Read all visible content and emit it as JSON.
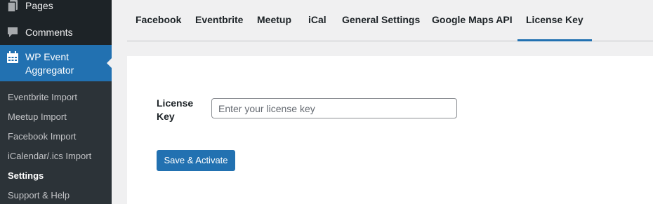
{
  "sidebar": {
    "menu": [
      {
        "label": "Pages",
        "icon": "pages-icon"
      },
      {
        "label": "Comments",
        "icon": "comments-icon"
      }
    ],
    "active": {
      "label": "WP Event Aggregator",
      "icon": "calendar-icon"
    },
    "submenu": [
      {
        "label": "Eventbrite Import"
      },
      {
        "label": "Meetup Import"
      },
      {
        "label": "Facebook Import"
      },
      {
        "label": "iCalendar/.ics Import"
      },
      {
        "label": "Settings",
        "current": true
      },
      {
        "label": "Support & Help"
      }
    ]
  },
  "tabs": [
    {
      "label": "Facebook"
    },
    {
      "label": "Eventbrite"
    },
    {
      "label": "Meetup"
    },
    {
      "label": "iCal"
    },
    {
      "label": "General Settings"
    },
    {
      "label": "Google Maps API"
    },
    {
      "label": "License Key",
      "active": true
    }
  ],
  "form": {
    "license_label": "License Key",
    "license_placeholder": "Enter your license key",
    "license_value": "",
    "save_label": "Save & Activate"
  },
  "colors": {
    "sidebar_bg": "#1d2327",
    "submenu_bg": "#2c3338",
    "accent": "#2271b1",
    "page_bg": "#f0f0f1"
  }
}
